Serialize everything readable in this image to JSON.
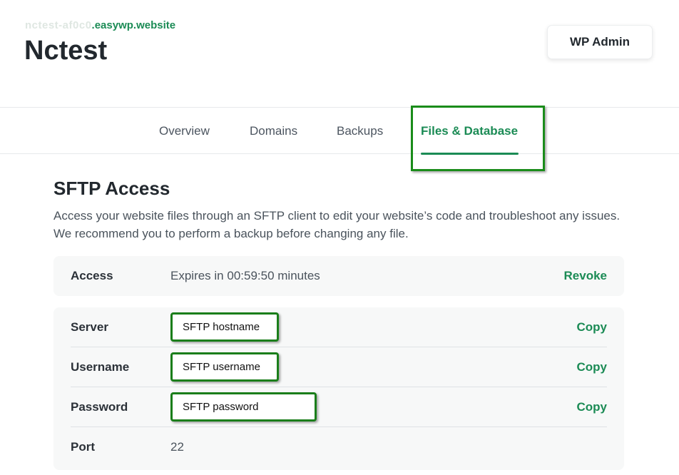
{
  "header": {
    "subdomain_prefix": "nctest-af0c0",
    "subdomain_suffix": ".easywp.website",
    "site_name": "Nctest",
    "wp_admin_label": "WP Admin"
  },
  "tabs": [
    {
      "label": "Overview",
      "active": false
    },
    {
      "label": "Domains",
      "active": false
    },
    {
      "label": "Backups",
      "active": false
    },
    {
      "label": "Files & Database",
      "active": true
    }
  ],
  "sftp": {
    "title": "SFTP Access",
    "description": "Access your website files through an SFTP client to edit your website’s code and troubleshoot any issues. We recommend you to perform a backup before changing any file.",
    "access": {
      "label": "Access",
      "value": "Expires in 00:59:50 minutes",
      "action": "Revoke"
    },
    "credentials": [
      {
        "label": "Server",
        "value": "SFTP hostname",
        "action": "Copy"
      },
      {
        "label": "Username",
        "value": "SFTP username",
        "action": "Copy"
      },
      {
        "label": "Password",
        "value": "SFTP password",
        "action": "Copy"
      },
      {
        "label": "Port",
        "value": "22"
      }
    ]
  },
  "colors": {
    "accent": "#1b8b55",
    "highlight": "#1a8c1a"
  }
}
